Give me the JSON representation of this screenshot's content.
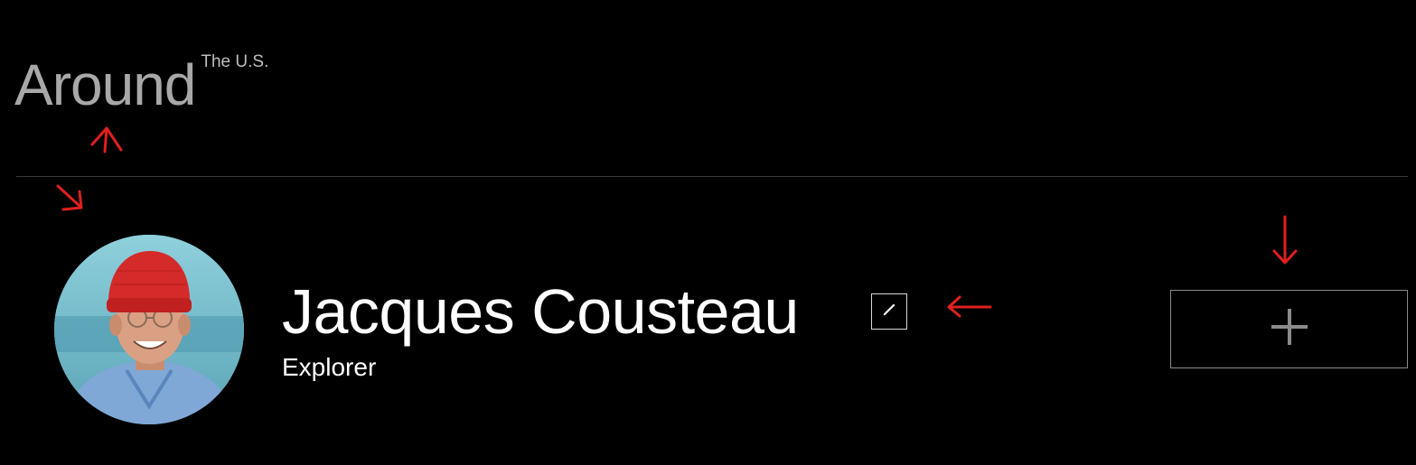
{
  "header": {
    "logo_text": "Around",
    "logo_superscript": "The U.S."
  },
  "profile": {
    "name": "Jacques Cousteau",
    "role": "Explorer",
    "edit_icon": "pencil-icon",
    "add_icon": "plus-icon"
  },
  "annotations": {
    "color": "#e02020",
    "arrows": [
      "arrow-up",
      "arrow-down-right",
      "arrow-left",
      "arrow-down"
    ]
  },
  "colors": {
    "background": "#000000",
    "logo": "#a8a8a8",
    "name": "#ffffff",
    "avatar_hat": "#d42a2a"
  }
}
